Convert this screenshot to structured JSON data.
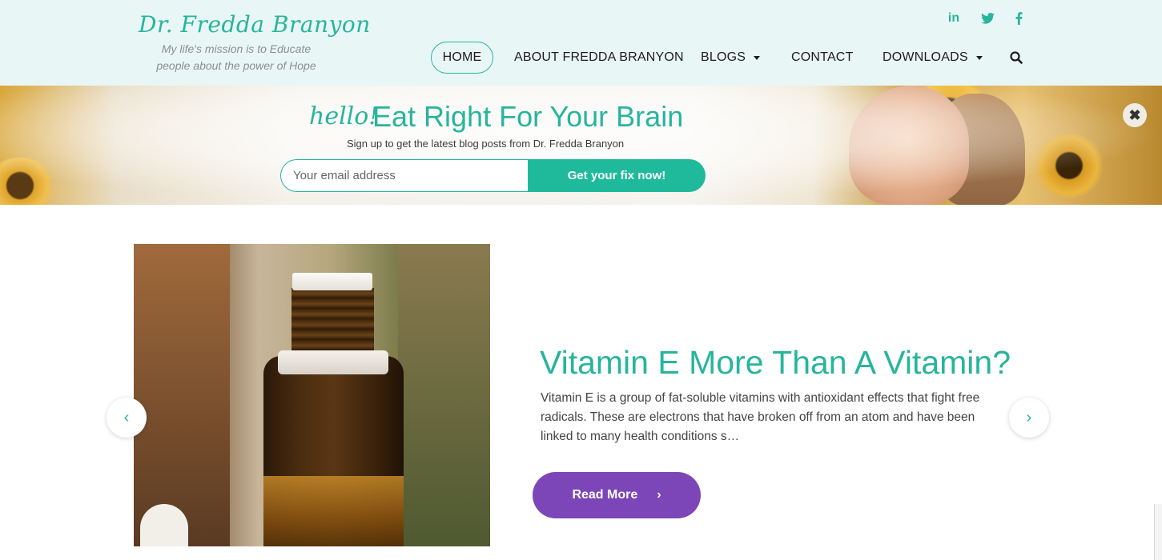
{
  "header": {
    "logo": "Dr. Fredda Branyon",
    "tagline": "My life's mission is to Educate people about the power of Hope",
    "social": [
      {
        "name": "linkedin-icon",
        "label": "in"
      },
      {
        "name": "twitter-icon"
      },
      {
        "name": "facebook-icon"
      }
    ],
    "nav": {
      "home": "HOME",
      "about": "ABOUT FREDDA BRANYON",
      "blogs": "BLOGS",
      "contact": "CONTACT",
      "downloads": "DOWNLOADS"
    }
  },
  "banner": {
    "hello": "hello!",
    "title": "Eat Right For Your Brain",
    "subtitle": "Sign up to get the latest blog posts from Dr. Fredda Branyon",
    "email_placeholder": "Your email address",
    "button": "Get your fix now!",
    "close": "✖"
  },
  "slide": {
    "title": "Vitamin E More Than A Vitamin?",
    "excerpt": "Vitamin E is a group of fat-soluble vitamins with antioxidant effects that fight free radicals.  These are electrons that have broken off from an atom and have been linked to many health conditions s…",
    "read_more": "Read More",
    "prev": "‹",
    "next": "›"
  },
  "colors": {
    "accent": "#27b59c",
    "button_green": "#1fba9b",
    "read_more_purple": "#7c46b8",
    "header_bg": "#e9f6f6"
  }
}
